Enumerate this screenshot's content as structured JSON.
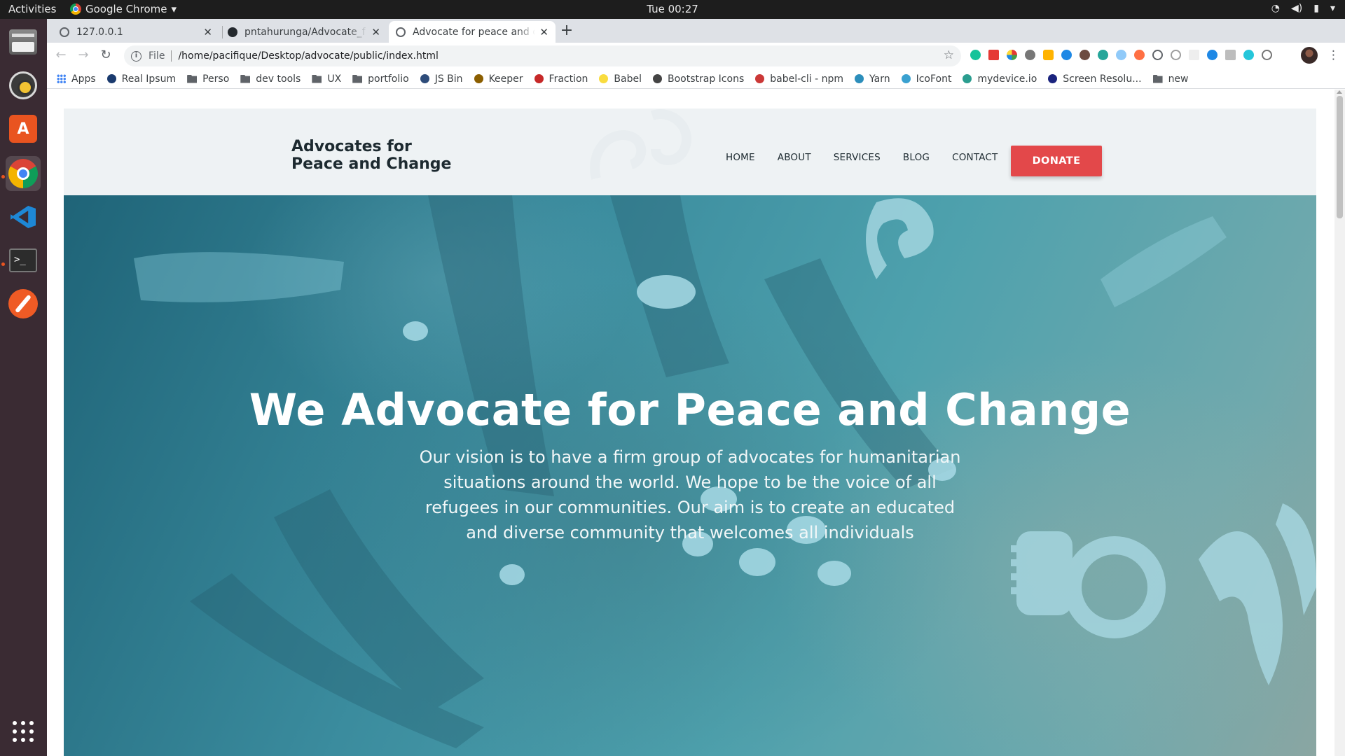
{
  "system": {
    "activities": "Activities",
    "app_name": "Google Chrome",
    "clock": "Tue 00:27"
  },
  "tabs": [
    {
      "title": "127.0.0.1"
    },
    {
      "title": "pntahurunga/Advocate_f"
    },
    {
      "title": "Advocate for peace and ch"
    }
  ],
  "address": {
    "scheme": "File",
    "url": "/home/pacifique/Desktop/advocate/public/index.html"
  },
  "bookmarks": [
    {
      "label": "Apps",
      "icon": "apps-icon"
    },
    {
      "label": "Real Ipsum",
      "icon": "bookmark-icon"
    },
    {
      "label": "Perso",
      "icon": "folder-icon"
    },
    {
      "label": "dev tools",
      "icon": "folder-icon"
    },
    {
      "label": "UX",
      "icon": "folder-icon"
    },
    {
      "label": "portfolio",
      "icon": "folder-icon"
    },
    {
      "label": "JS Bin",
      "icon": "jsbin-icon"
    },
    {
      "label": "Keeper",
      "icon": "keeper-icon"
    },
    {
      "label": "Fraction",
      "icon": "fraction-icon"
    },
    {
      "label": "Babel",
      "icon": "babel-icon"
    },
    {
      "label": "Bootstrap Icons",
      "icon": "globe-icon"
    },
    {
      "label": "babel-cli - npm",
      "icon": "npm-icon"
    },
    {
      "label": "Yarn",
      "icon": "yarn-icon"
    },
    {
      "label": "IcoFont",
      "icon": "icofont-icon"
    },
    {
      "label": "mydevice.io",
      "icon": "mydevice-icon"
    },
    {
      "label": "Screen Resolu...",
      "icon": "screen-icon"
    },
    {
      "label": "new",
      "icon": "folder-icon"
    }
  ],
  "site": {
    "brand_line1": "Advocates for",
    "brand_line2": "Peace and Change",
    "nav": [
      "HOME",
      "ABOUT",
      "SERVICES",
      "BLOG",
      "CONTACT"
    ],
    "donate": "DONATE",
    "hero_title": "We Advocate for Peace and Change",
    "hero_text": "Our vision is to have a firm group of advocates for humanitarian situations around the world. We hope to be the voice of all refugees in our communities. Our aim is to create an educated and diverse community that welcomes all individuals"
  },
  "colors": {
    "donate": "#e3484a",
    "hero_teal": "#3b8c9e",
    "header_bg": "#eef2f4",
    "dock_bg": "#3a2b33"
  }
}
